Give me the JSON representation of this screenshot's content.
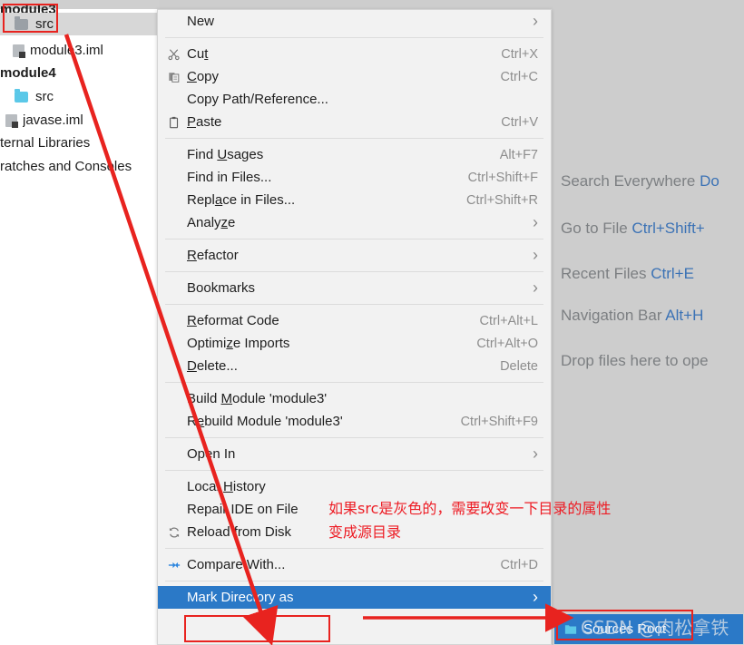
{
  "project_tree": {
    "items": [
      {
        "label": "module3",
        "icon": "folder-icon",
        "indent": 0,
        "bold": true,
        "selected": false,
        "cut_top": true
      },
      {
        "label": "src",
        "icon": "folder-gray-icon",
        "indent": 1,
        "bold": false,
        "selected": true
      },
      {
        "label": "module3.iml",
        "icon": "iml-file-icon",
        "indent": 1,
        "bold": false,
        "selected": false
      },
      {
        "label": "module4",
        "icon": "module-icon",
        "indent": 0,
        "bold": true,
        "selected": false
      },
      {
        "label": "src",
        "icon": "folder-blue-icon",
        "indent": 1,
        "bold": false,
        "selected": false
      },
      {
        "label": "javase.iml",
        "icon": "iml-file-icon",
        "indent": 0,
        "bold": false,
        "selected": false
      },
      {
        "label": "ternal Libraries",
        "icon": "library-icon",
        "indent": 0,
        "bold": false,
        "selected": false
      },
      {
        "label": "ratches and Consoles",
        "icon": "scratches-icon",
        "indent": 0,
        "bold": false,
        "selected": false
      }
    ]
  },
  "context_menu": {
    "groups": [
      {
        "items": [
          {
            "label": "New",
            "accel": "",
            "arrow": true,
            "icon": "",
            "underline": ""
          }
        ]
      },
      {
        "items": [
          {
            "label": "Cut",
            "accel": "Ctrl+X",
            "arrow": false,
            "icon": "scissors-icon",
            "underline": "t"
          },
          {
            "label": "Copy",
            "accel": "Ctrl+C",
            "arrow": false,
            "icon": "copy-icon",
            "underline": "C"
          },
          {
            "label": "Copy Path/Reference...",
            "accel": "",
            "arrow": false,
            "icon": "",
            "underline": ""
          },
          {
            "label": "Paste",
            "accel": "Ctrl+V",
            "arrow": false,
            "icon": "clipboard-icon",
            "underline": "P"
          }
        ]
      },
      {
        "items": [
          {
            "label": "Find Usages",
            "accel": "Alt+F7",
            "arrow": false,
            "icon": "",
            "underline": "U"
          },
          {
            "label": "Find in Files...",
            "accel": "Ctrl+Shift+F",
            "arrow": false,
            "icon": "",
            "underline": ""
          },
          {
            "label": "Replace in Files...",
            "accel": "Ctrl+Shift+R",
            "arrow": false,
            "icon": "",
            "underline": "a"
          },
          {
            "label": "Analyze",
            "accel": "",
            "arrow": true,
            "icon": "",
            "underline": "z"
          }
        ]
      },
      {
        "items": [
          {
            "label": "Refactor",
            "accel": "",
            "arrow": true,
            "icon": "",
            "underline": "R"
          }
        ]
      },
      {
        "items": [
          {
            "label": "Bookmarks",
            "accel": "",
            "arrow": true,
            "icon": "",
            "underline": ""
          }
        ]
      },
      {
        "items": [
          {
            "label": "Reformat Code",
            "accel": "Ctrl+Alt+L",
            "arrow": false,
            "icon": "",
            "underline": "R"
          },
          {
            "label": "Optimize Imports",
            "accel": "Ctrl+Alt+O",
            "arrow": false,
            "icon": "",
            "underline": "z"
          },
          {
            "label": "Delete...",
            "accel": "Delete",
            "arrow": false,
            "icon": "",
            "underline": "D"
          }
        ]
      },
      {
        "items": [
          {
            "label": "Build Module 'module3'",
            "accel": "",
            "arrow": false,
            "icon": "",
            "underline": "M"
          },
          {
            "label": "Rebuild Module 'module3'",
            "accel": "Ctrl+Shift+F9",
            "arrow": false,
            "icon": "",
            "underline": "e"
          }
        ]
      },
      {
        "items": [
          {
            "label": "Open In",
            "accel": "",
            "arrow": true,
            "icon": "",
            "underline": ""
          }
        ]
      },
      {
        "items": [
          {
            "label": "Local History",
            "accel": "",
            "arrow": false,
            "icon": "",
            "underline": "H"
          },
          {
            "label": "Repair IDE on File",
            "accel": "",
            "arrow": false,
            "icon": "",
            "underline": ""
          },
          {
            "label": "Reload from Disk",
            "accel": "",
            "arrow": false,
            "icon": "reload-icon",
            "underline": ""
          }
        ]
      },
      {
        "items": [
          {
            "label": "Compare With...",
            "accel": "Ctrl+D",
            "arrow": false,
            "icon": "compare-icon",
            "underline": ""
          }
        ]
      },
      {
        "items": [
          {
            "label": "Mark Directory as",
            "accel": "",
            "arrow": true,
            "icon": "",
            "underline": "",
            "selected": true
          }
        ]
      }
    ]
  },
  "submenu": {
    "items": [
      {
        "label": "Sources Root",
        "icon": "folder-blue-icon",
        "selected": true
      }
    ]
  },
  "editor_hints": [
    {
      "text": "Search Everywhere ",
      "kbd": "Do"
    },
    {
      "text": "Go to File ",
      "kbd": "Ctrl+Shift+"
    },
    {
      "text": "Recent Files ",
      "kbd": "Ctrl+E"
    },
    {
      "text": "Navigation Bar ",
      "kbd": "Alt+H"
    },
    {
      "text": "Drop files here to ope",
      "kbd": ""
    }
  ],
  "annotation": {
    "text": "如果src是灰色的，需要改变一下目录的属性\n变成源目录",
    "color": "#ed1c24"
  },
  "watermark": {
    "text": "CSDN @肉松拿铁"
  },
  "colors": {
    "highlight_blue": "#2b79c7",
    "annotation_red": "#e8231f",
    "menu_bg": "#f2f2f2",
    "editor_bg": "#cdcdcd",
    "accel_gray": "#8d8d8d",
    "kbd_blue": "#3b72b5"
  }
}
